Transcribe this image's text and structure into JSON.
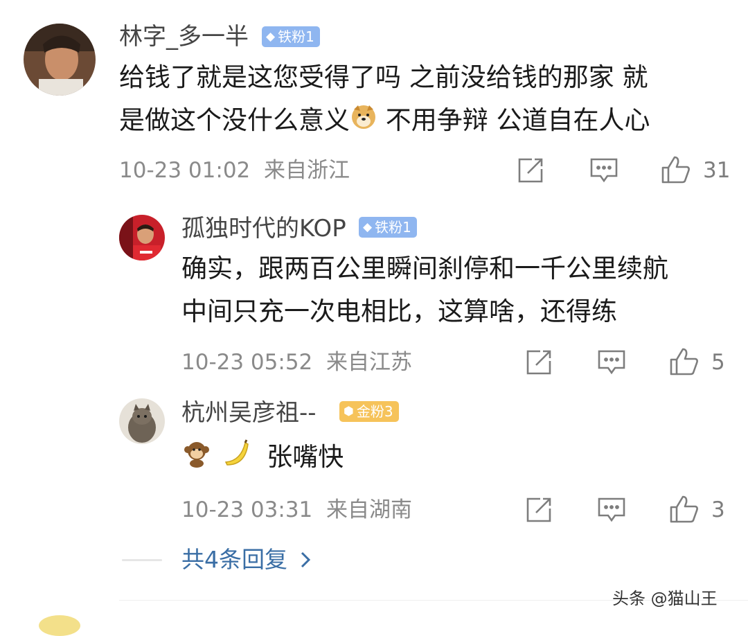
{
  "comment": {
    "username": "林字_多一半",
    "badge": "铁粉1",
    "text_line1": "给钱了就是这您受得了吗 之前没给钱的那家 就",
    "text_line2a": "是做这个没什么意义",
    "text_line2b": " 不用争辩 公道自在人心",
    "timestamp": "10-23 01:02",
    "location": "来自浙江",
    "likes": "31"
  },
  "replies": [
    {
      "username": "孤独时代的KOP",
      "badge": "铁粉1",
      "text_line1": "确实，跟两百公里瞬间刹停和一千公里续航",
      "text_line2": "中间只充一次电相比，这算啥，还得练",
      "timestamp": "10-23 05:52",
      "location": "来自江苏",
      "likes": "5"
    },
    {
      "username": "杭州吴彦祖--",
      "badge": "金粉3",
      "text": "张嘴快",
      "timestamp": "10-23 03:31",
      "location": "来自湖南",
      "likes": "3"
    }
  ],
  "more_replies": "共4条回复",
  "watermark": "头条 @猫山王",
  "icons": [
    "share-icon",
    "comment-icon",
    "like-icon",
    "chevron-right-icon",
    "doge-emoji",
    "monkey-emoji",
    "banana-emoji"
  ],
  "colors": {
    "link": "#3a6ea5",
    "meta": "#8a8a8a",
    "badge_iron": "#8fb6f0",
    "badge_gold": "#f6c35a"
  }
}
